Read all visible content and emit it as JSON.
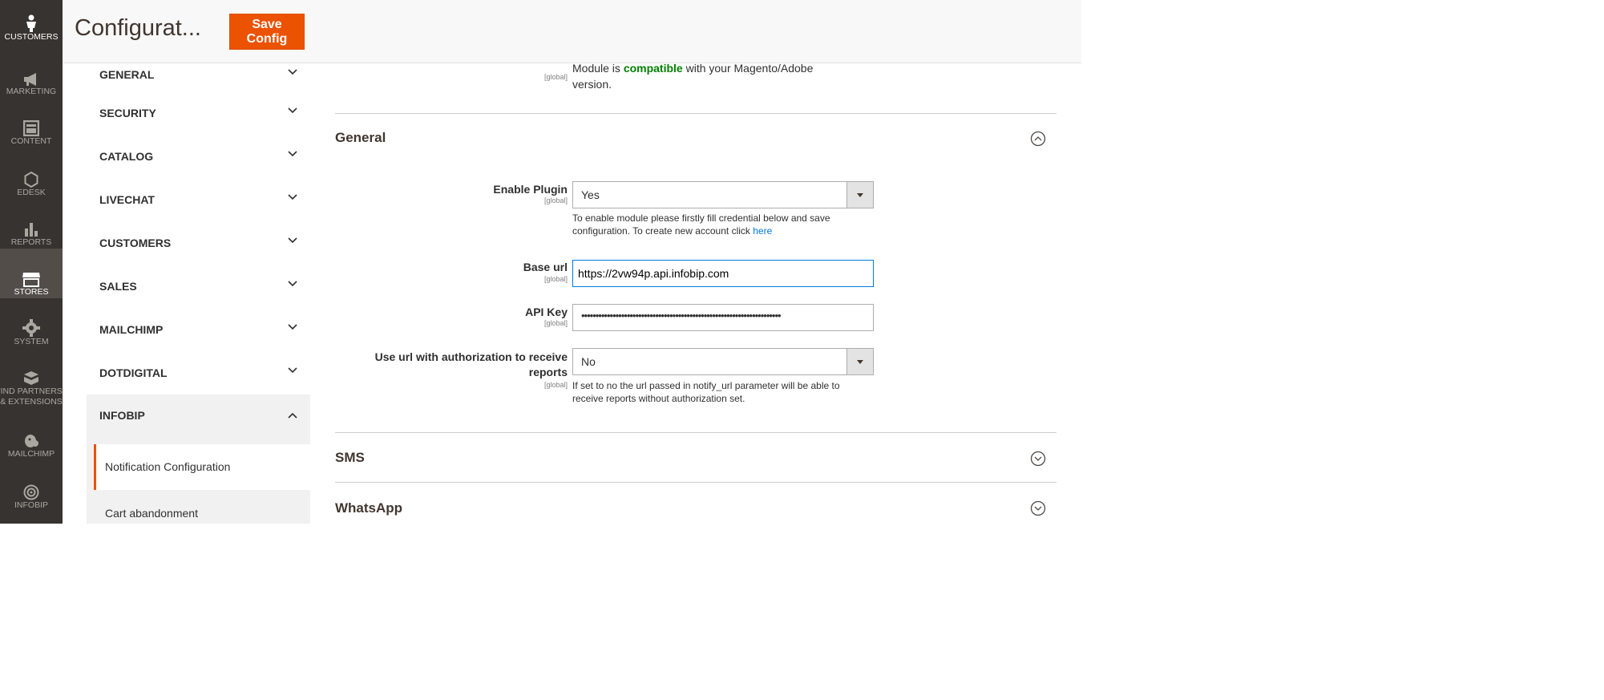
{
  "header": {
    "title": "Configurat...",
    "save_label": "Save Config"
  },
  "admin_menu": [
    {
      "label": "CUSTOMERS",
      "icon": "customer-icon"
    },
    {
      "label": "MARKETING",
      "icon": "megaphone-icon"
    },
    {
      "label": "CONTENT",
      "icon": "layout-icon"
    },
    {
      "label": "EDESK",
      "icon": "hexagon-icon"
    },
    {
      "label": "REPORTS",
      "icon": "bar-chart-icon"
    },
    {
      "label": "STORES",
      "icon": "store-icon",
      "active": true
    },
    {
      "label": "SYSTEM",
      "icon": "gear-icon"
    },
    {
      "label": "FIND PARTNERS",
      "label2": "& EXTENSIONS",
      "icon": "blocks-icon"
    },
    {
      "label": "MAILCHIMP",
      "icon": "mailchimp-icon"
    },
    {
      "label": "INFOBIP",
      "icon": "target-icon"
    }
  ],
  "config_tabs": [
    {
      "label": "GENERAL"
    },
    {
      "label": "SECURITY"
    },
    {
      "label": "CATALOG"
    },
    {
      "label": "LIVECHAT"
    },
    {
      "label": "CUSTOMERS"
    },
    {
      "label": "SALES"
    },
    {
      "label": "MAILCHIMP"
    },
    {
      "label": "DOTDIGITAL"
    },
    {
      "label": "INFOBIP",
      "open": true
    }
  ],
  "infobip_items": [
    {
      "label": "Notification Configuration",
      "active": true
    },
    {
      "label": "Cart abandonment"
    }
  ],
  "compat": {
    "scope": "[global]",
    "prefix": "Module is ",
    "status": "compatible",
    "suffix": " with your Magento/Adobe",
    "line2": "version."
  },
  "general": {
    "title": "General",
    "enable_plugin": {
      "label": "Enable Plugin",
      "scope": "[global]",
      "value": "Yes",
      "note_line1": "To enable module please firstly fill credential below and save",
      "note_line2": "configuration. To create new account click ",
      "note_link": "here"
    },
    "base_url": {
      "label": "Base url",
      "scope": "[global]",
      "value": "https://2vw94p.api.infobip.com"
    },
    "api_key": {
      "label": "API Key",
      "scope": "[global]",
      "value": "••••••••••••••••••••••••••••••••••••••••••••••••••••••••••••••••••••••"
    },
    "auth_url": {
      "label_line1": "Use url with authorization to receive",
      "label_line2": "reports",
      "scope": "[global]",
      "value": "No",
      "note_line1": "If set to no the url passed in notify_url parameter will be able to",
      "note_line2": "receive reports without authorization set."
    }
  },
  "sections": [
    {
      "title": "SMS"
    },
    {
      "title": "WhatsApp"
    }
  ],
  "colors": {
    "accent": "#eb5202",
    "compatible": "#008000",
    "link": "#007bdb",
    "menu_bg": "#373330"
  }
}
